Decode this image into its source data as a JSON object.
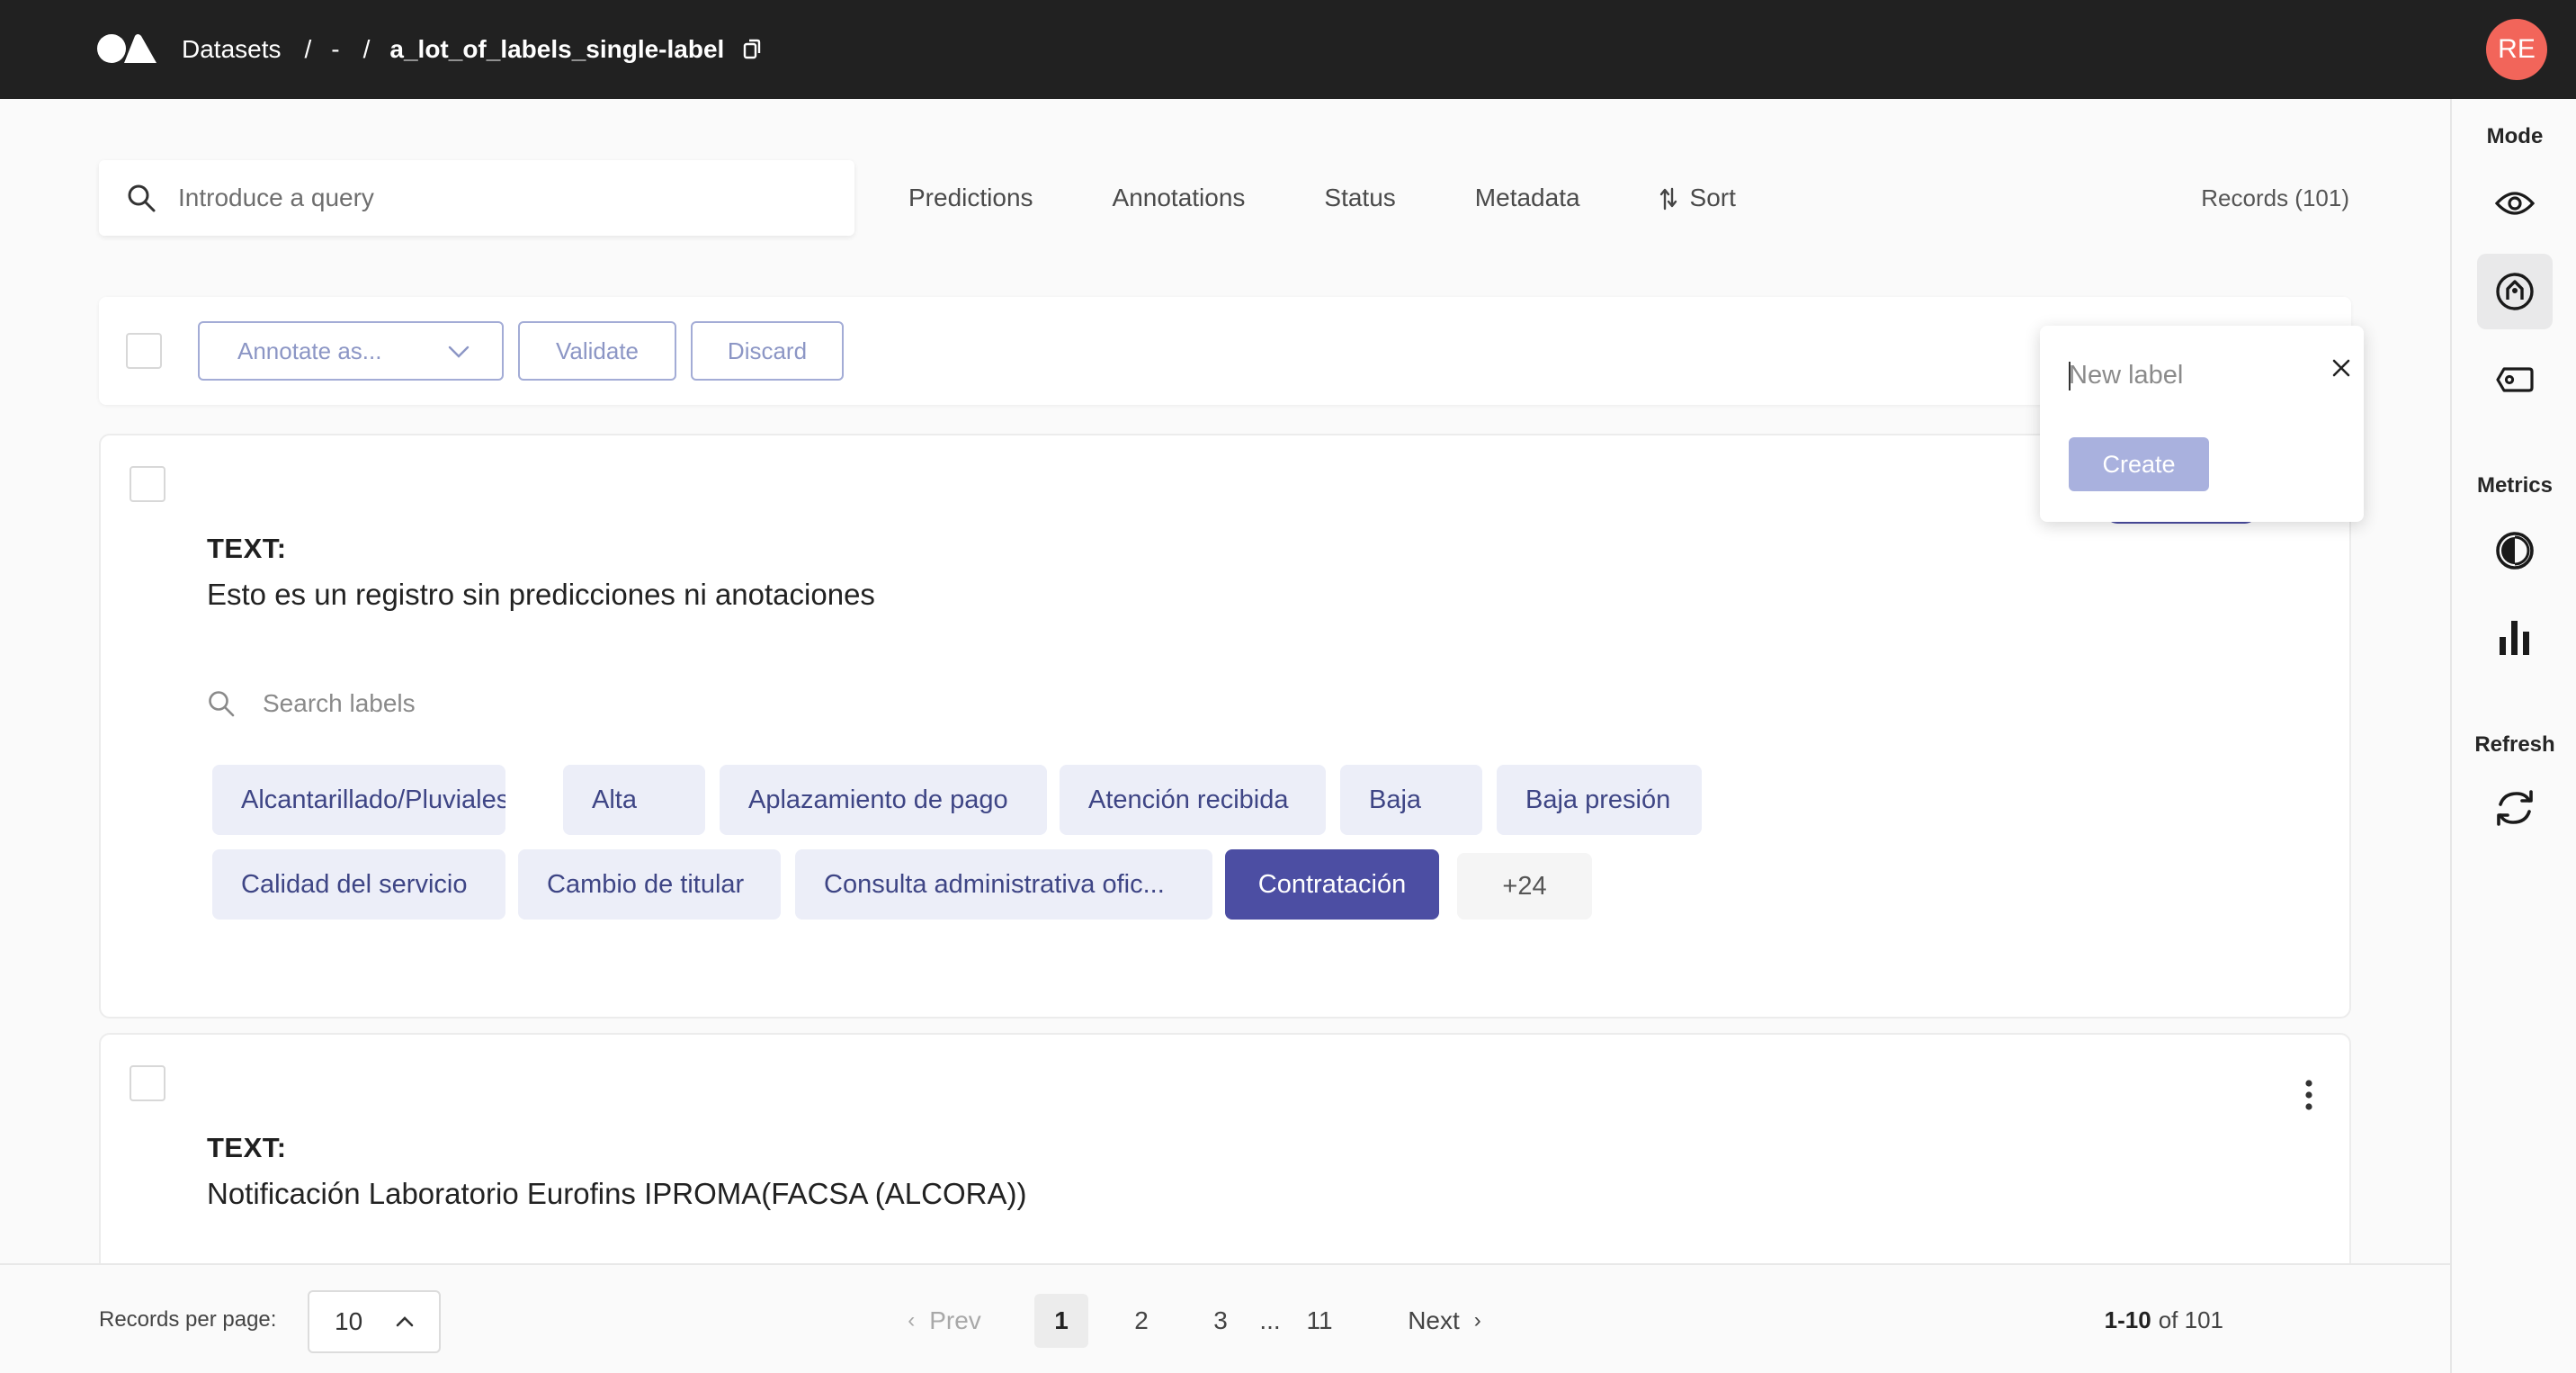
{
  "header": {
    "crumbs": [
      "Datasets",
      "-"
    ],
    "separator": "/",
    "dataset_name": "a_lot_of_labels_single-label",
    "avatar_initials": "RE"
  },
  "search": {
    "placeholder": "Introduce a query"
  },
  "filters": {
    "predictions": "Predictions",
    "annotations": "Annotations",
    "status": "Status",
    "metadata": "Metadata",
    "sort": "Sort"
  },
  "records_count": "Records (101)",
  "bulk": {
    "annotate_as": "Annotate as...",
    "validate": "Validate",
    "discard": "Discard"
  },
  "sidebar": {
    "mode_label": "Mode",
    "metrics_label": "Metrics",
    "refresh_label": "Refresh"
  },
  "record1": {
    "field_label": "TEXT:",
    "text": "Esto es un registro sin predicciones ni anotaciones",
    "label_search_placeholder": "Search labels",
    "labels": [
      "Alcantarillado/Pluviales",
      "Alta",
      "Aplazamiento de pago",
      "Atención recibida",
      "Baja",
      "Baja presión",
      "Calidad del servicio",
      "Cambio de titular",
      "Consulta administrativa ofic...",
      "Contratación"
    ],
    "selected_label": "Contratación",
    "more_labels": "+24"
  },
  "record2": {
    "field_label": "TEXT:",
    "text": "Notificación Laboratorio Eurofins IPROMA(FACSA (ALCORA))"
  },
  "popover": {
    "placeholder": "New label",
    "create": "Create"
  },
  "footer": {
    "records_per_page_label": "Records per page:",
    "records_per_page": "10",
    "prev": "Prev",
    "next": "Next",
    "pages": [
      "1",
      "2",
      "3",
      "...",
      "11"
    ],
    "current_page": "1",
    "range_bold": "1-10",
    "range_rest": "of 101"
  },
  "colors": {
    "topbar": "#212121",
    "avatar": "#f2655a",
    "chip_bg": "#eceef8",
    "chip_text": "#3e4585",
    "chip_selected": "#4c4ea3",
    "create_button": "#a9b1de"
  }
}
